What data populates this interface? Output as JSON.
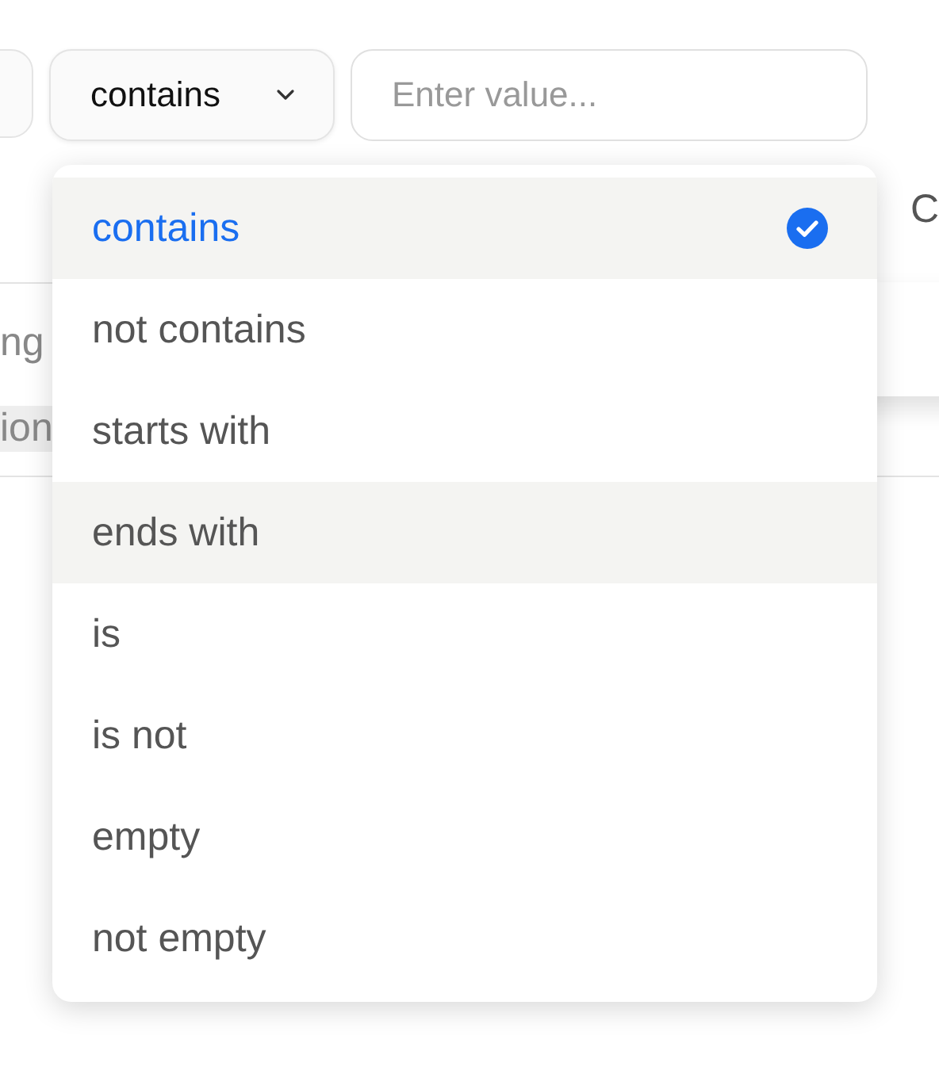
{
  "filter_bar": {
    "operator": "contains",
    "value_field": {
      "placeholder": "Enter value..."
    }
  },
  "background": {
    "header_fragment": "C",
    "row_fragments": [
      "ng",
      "ion"
    ]
  },
  "operator_menu": {
    "options": [
      {
        "label": "contains",
        "selected": true,
        "highlighted": true
      },
      {
        "label": "not contains",
        "selected": false,
        "highlighted": false
      },
      {
        "label": "starts with",
        "selected": false,
        "highlighted": false
      },
      {
        "label": "ends with",
        "selected": false,
        "highlighted": true
      },
      {
        "label": "is",
        "selected": false,
        "highlighted": false
      },
      {
        "label": "is not",
        "selected": false,
        "highlighted": false
      },
      {
        "label": "empty",
        "selected": false,
        "highlighted": false
      },
      {
        "label": "not empty",
        "selected": false,
        "highlighted": false
      }
    ]
  }
}
